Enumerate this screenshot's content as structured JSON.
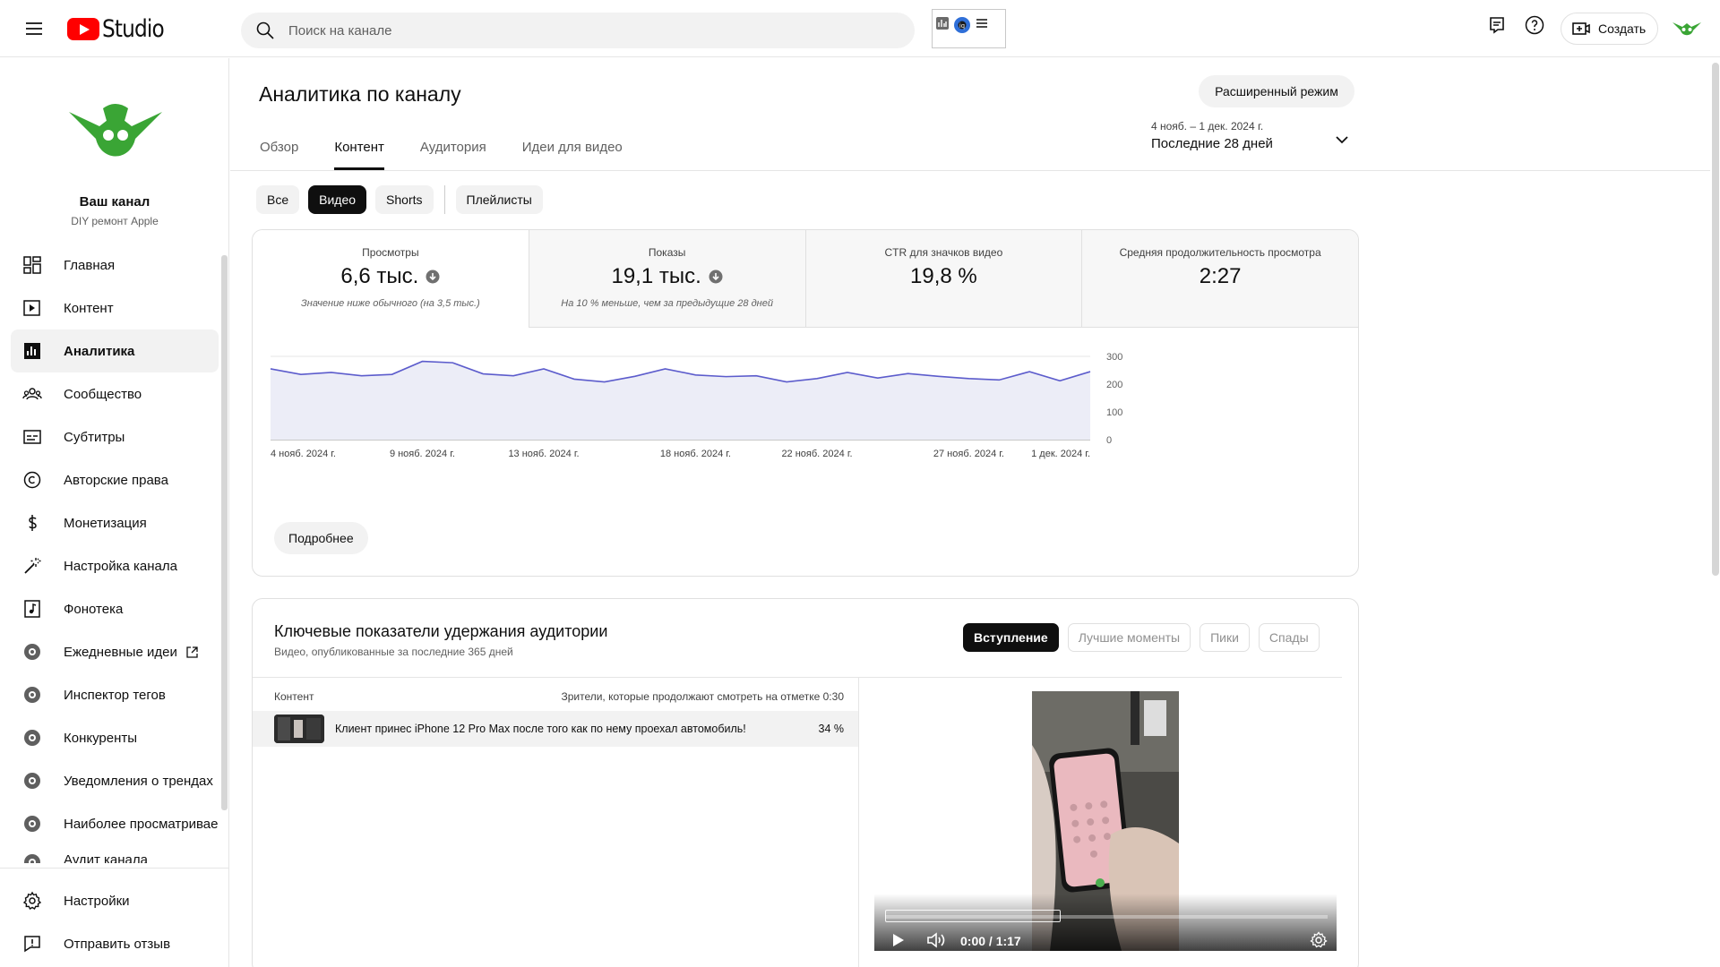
{
  "header": {
    "logo_text": "Studio",
    "search_placeholder": "Поиск на канале",
    "create_label": "Создать"
  },
  "sidebar": {
    "channel_name": "Ваш канал",
    "channel_sub": "DIY ремонт Apple",
    "items": [
      {
        "label": "Главная",
        "icon": "dashboard-icon"
      },
      {
        "label": "Контент",
        "icon": "content-icon"
      },
      {
        "label": "Аналитика",
        "icon": "analytics-icon",
        "active": true
      },
      {
        "label": "Сообщество",
        "icon": "community-icon"
      },
      {
        "label": "Субтитры",
        "icon": "subtitles-icon"
      },
      {
        "label": "Авторские права",
        "icon": "copyright-icon"
      },
      {
        "label": "Монетизация",
        "icon": "monetization-icon"
      },
      {
        "label": "Настройка канала",
        "icon": "customization-icon"
      },
      {
        "label": "Фонотека",
        "icon": "audio-library-icon"
      },
      {
        "label": "Ежедневные идеи",
        "icon": "extension-icon",
        "external": true
      },
      {
        "label": "Инспектор тегов",
        "icon": "extension-icon"
      },
      {
        "label": "Конкуренты",
        "icon": "extension-icon"
      },
      {
        "label": "Уведомления о трендах",
        "icon": "extension-icon"
      },
      {
        "label": "Наиболее просматриваемые",
        "icon": "extension-icon"
      },
      {
        "label": "Аудит канала",
        "icon": "extension-icon"
      }
    ],
    "bottom": [
      {
        "label": "Настройки",
        "icon": "settings-icon"
      },
      {
        "label": "Отправить отзыв",
        "icon": "feedback-icon"
      }
    ]
  },
  "main": {
    "title": "Аналитика по каналу",
    "advanced_button": "Расширенный режим",
    "tabs": [
      "Обзор",
      "Контент",
      "Аудитория",
      "Идеи для видео"
    ],
    "active_tab": "Контент",
    "date_range_small": "4 нояб. – 1 дек. 2024 г.",
    "date_range_main": "Последние 28 дней",
    "chips": [
      "Все",
      "Видео",
      "Shorts",
      "Плейлисты"
    ],
    "active_chip": "Видео"
  },
  "metrics": [
    {
      "label": "Просмотры",
      "value": "6,6 тыс.",
      "note": "Значение ниже обычного (на 3,5 тыс.)",
      "trend": "down"
    },
    {
      "label": "Показы",
      "value": "19,1 тыс.",
      "note": "На 10 % меньше, чем за предыдущие 28 дней",
      "trend": "down"
    },
    {
      "label": "CTR для значков видео",
      "value": "19,8 %",
      "note": ""
    },
    {
      "label": "Средняя продолжительность просмотра",
      "value": "2:27",
      "note": ""
    }
  ],
  "more_button": "Подробнее",
  "chart_data": {
    "type": "area",
    "x_tick_labels": [
      "4 нояб. 2024 г.",
      "9 нояб. 2024 г.",
      "13 нояб. 2024 г.",
      "18 нояб. 2024 г.",
      "22 нояб. 2024 г.",
      "27 нояб. 2024 г.",
      "1 дек. 2024 г."
    ],
    "x_tick_day_index": [
      0,
      5,
      9,
      14,
      18,
      23,
      27
    ],
    "y_ticks": [
      0,
      100,
      200,
      300
    ],
    "ylim": [
      0,
      300
    ],
    "values": [
      255,
      235,
      242,
      230,
      235,
      282,
      277,
      237,
      230,
      255,
      218,
      208,
      228,
      255,
      233,
      227,
      230,
      208,
      220,
      242,
      222,
      238,
      228,
      220,
      215,
      245,
      212,
      245
    ],
    "series_color": "#5c5ccc",
    "fill_color": "#ecedf7",
    "grid": true
  },
  "retention": {
    "title": "Ключевые показатели удержания аудитории",
    "subtitle": "Видео, опубликованные за последние 365 дней",
    "tabs": [
      "Вступление",
      "Лучшие моменты",
      "Пики",
      "Спады"
    ],
    "active_tab": "Вступление",
    "col_content": "Контент",
    "col_metric": "Зрители, которые продолжают смотреть на отметке 0:30",
    "rows": [
      {
        "title": "Клиент принес iPhone 12 Pro Max после того как по нему проехал автомобиль!",
        "value": "34 %"
      }
    ],
    "player_time": "0:00 / 1:17",
    "player_progress": 0
  }
}
